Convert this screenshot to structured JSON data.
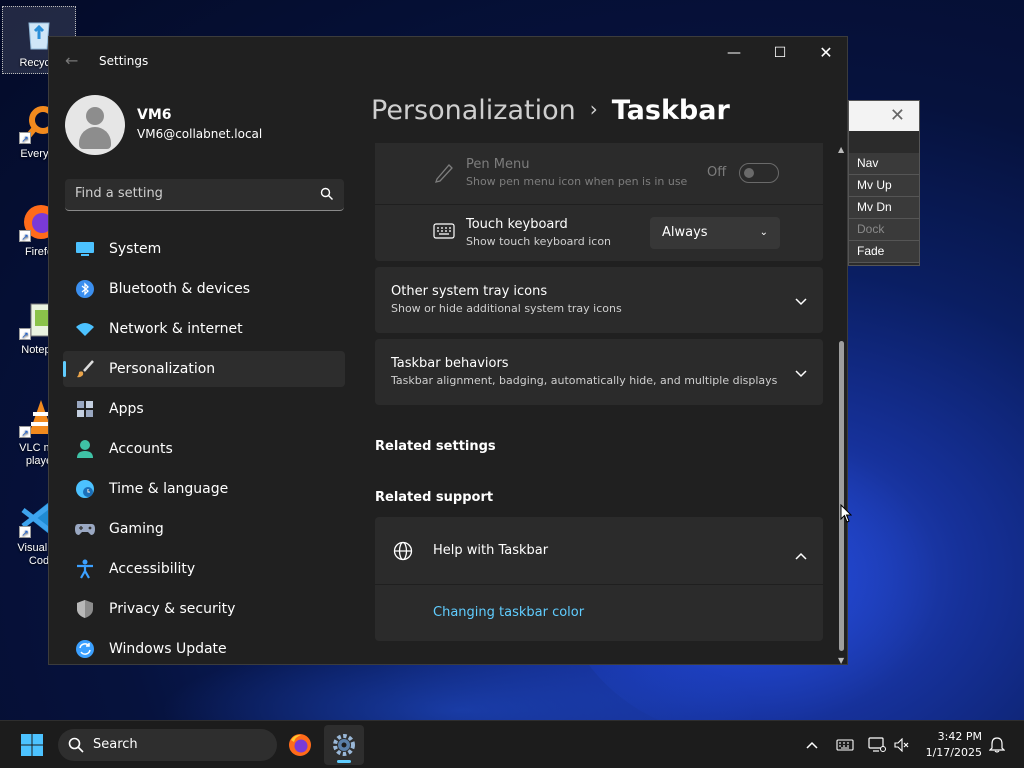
{
  "desktop": {
    "icons": [
      {
        "label": "Recycle",
        "icon": "recycle-bin-icon"
      },
      {
        "label": "Everyth",
        "icon": "everything-search-icon"
      },
      {
        "label": "Firefo",
        "icon": "firefox-icon"
      },
      {
        "label": "Notepa",
        "icon": "notepad-icon"
      },
      {
        "label": "VLC me playe",
        "icon": "vlc-icon"
      },
      {
        "label": "Visual St Cod",
        "icon": "vscode-icon"
      }
    ]
  },
  "side_panel": {
    "buttons": [
      "Nav",
      "Mv Up",
      "Mv Dn",
      "Dock",
      "Fade"
    ]
  },
  "window": {
    "title": "Settings",
    "controls": {
      "minimize": "—",
      "maximize": "☐",
      "close": "✕"
    }
  },
  "profile": {
    "name": "VM6",
    "email": "VM6@collabnet.local"
  },
  "search": {
    "placeholder": "Find a setting"
  },
  "nav": {
    "items": [
      {
        "label": "System",
        "icon": "system-display-icon",
        "color": "#4cc2ff"
      },
      {
        "label": "Bluetooth & devices",
        "icon": "bluetooth-icon",
        "color": "#3b8fef"
      },
      {
        "label": "Network & internet",
        "icon": "wifi-icon",
        "color": "#4cc2ff"
      },
      {
        "label": "Personalization",
        "icon": "paintbrush-icon",
        "color": "#e8a34a",
        "active": true
      },
      {
        "label": "Apps",
        "icon": "apps-grid-icon",
        "color": "#9aa8c2"
      },
      {
        "label": "Accounts",
        "icon": "person-icon",
        "color": "#3fc2a6"
      },
      {
        "label": "Time & language",
        "icon": "globe-clock-icon",
        "color": "#4cc2ff"
      },
      {
        "label": "Gaming",
        "icon": "gamepad-icon",
        "color": "#9aa8c2"
      },
      {
        "label": "Accessibility",
        "icon": "accessibility-icon",
        "color": "#3ba0ff"
      },
      {
        "label": "Privacy & security",
        "icon": "shield-icon",
        "color": "#a0a0a0"
      },
      {
        "label": "Windows Update",
        "icon": "update-icon",
        "color": "#3ba0ff"
      }
    ]
  },
  "header": {
    "parent": "Personalization",
    "separator": "›",
    "current": "Taskbar"
  },
  "content": {
    "pen_menu": {
      "title": "Pen Menu",
      "subtitle": "Show pen menu icon when pen is in use",
      "state": "Off"
    },
    "touch_keyboard": {
      "title": "Touch keyboard",
      "subtitle": "Show touch keyboard icon",
      "value": "Always"
    },
    "other_tray": {
      "title": "Other system tray icons",
      "subtitle": "Show or hide additional system tray icons"
    },
    "behaviors": {
      "title": "Taskbar behaviors",
      "subtitle": "Taskbar alignment, badging, automatically hide, and multiple displays"
    },
    "related_settings": "Related settings",
    "related_support": "Related support",
    "help": {
      "title": "Help with Taskbar",
      "link": "Changing taskbar color"
    }
  },
  "taskbar": {
    "search_label": "Search",
    "time": "3:42 PM",
    "date": "1/17/2025"
  },
  "colors": {
    "accent": "#60cdff",
    "window_bg": "#202020",
    "card_bg": "#2b2b2b"
  }
}
